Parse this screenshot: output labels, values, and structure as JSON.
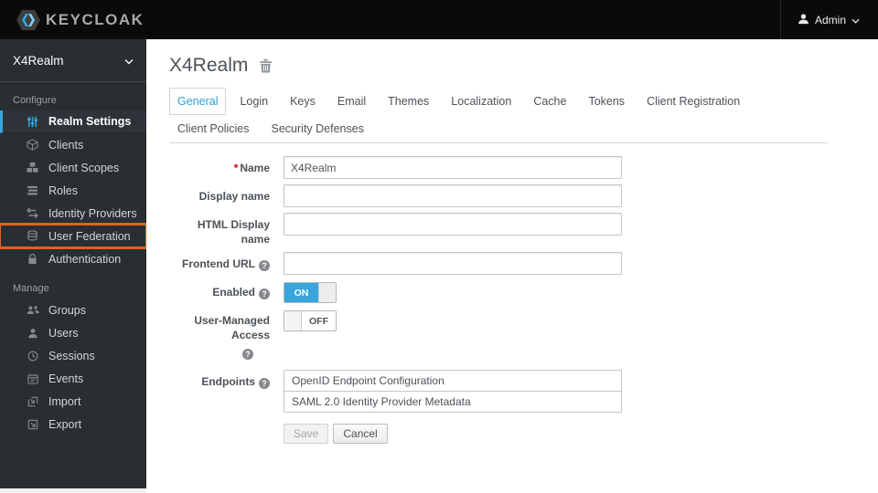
{
  "topbar": {
    "brand": "KEYCLOAK",
    "user_label": "Admin"
  },
  "sidebar": {
    "realm_selector": "X4Realm",
    "sections": [
      {
        "label": "Configure",
        "items": [
          {
            "label": "Realm Settings",
            "icon": "sliders-icon"
          },
          {
            "label": "Clients",
            "icon": "cube-icon"
          },
          {
            "label": "Client Scopes",
            "icon": "cubes-icon"
          },
          {
            "label": "Roles",
            "icon": "roles-icon"
          },
          {
            "label": "Identity Providers",
            "icon": "exchange-icon"
          },
          {
            "label": "User Federation",
            "icon": "database-icon"
          },
          {
            "label": "Authentication",
            "icon": "lock-icon"
          }
        ]
      },
      {
        "label": "Manage",
        "items": [
          {
            "label": "Groups",
            "icon": "group-icon"
          },
          {
            "label": "Users",
            "icon": "user-icon"
          },
          {
            "label": "Sessions",
            "icon": "clock-icon"
          },
          {
            "label": "Events",
            "icon": "calendar-icon"
          },
          {
            "label": "Import",
            "icon": "import-icon"
          },
          {
            "label": "Export",
            "icon": "export-icon"
          }
        ]
      }
    ]
  },
  "main": {
    "title": "X4Realm",
    "tabs": [
      "General",
      "Login",
      "Keys",
      "Email",
      "Themes",
      "Localization",
      "Cache",
      "Tokens",
      "Client Registration",
      "Client Policies",
      "Security Defenses"
    ],
    "active_tab": "General",
    "form": {
      "name_label": "Name",
      "name_value": "X4Realm",
      "display_name_label": "Display name",
      "html_display_name_label": "HTML Display name",
      "frontend_url_label": "Frontend URL",
      "enabled_label": "Enabled",
      "enabled_state": "ON",
      "uma_label": "User-Managed Access",
      "uma_state": "OFF",
      "endpoints_label": "Endpoints",
      "endpoints": [
        "OpenID Endpoint Configuration",
        "SAML 2.0 Identity Provider Metadata"
      ],
      "save_label": "Save",
      "cancel_label": "Cancel"
    }
  },
  "colors": {
    "accent_blue": "#39a5dc",
    "highlight_orange": "#e2611b",
    "topbar_bg": "#0a0a0a",
    "sidebar_bg": "#292e33",
    "active_tab_text": "#2d9fd8",
    "required_red": "#cc0000"
  }
}
